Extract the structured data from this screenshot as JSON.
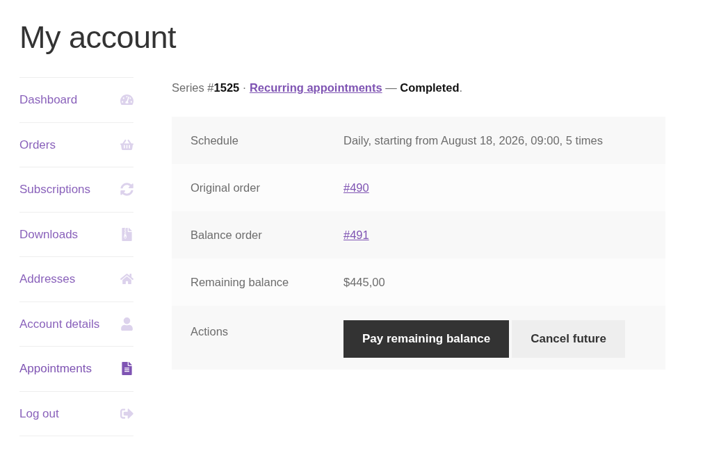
{
  "page": {
    "title": "My account"
  },
  "sidebar": {
    "items": [
      {
        "label": "Dashboard",
        "selected": false
      },
      {
        "label": "Orders",
        "selected": false
      },
      {
        "label": "Subscriptions",
        "selected": false
      },
      {
        "label": "Downloads",
        "selected": false
      },
      {
        "label": "Addresses",
        "selected": false
      },
      {
        "label": "Account details",
        "selected": false
      },
      {
        "label": "Appointments",
        "selected": true
      },
      {
        "label": "Log out",
        "selected": false
      }
    ]
  },
  "series": {
    "text_before": "Series #**1525** · ",
    "link": "Recurring appointments",
    "text_after": " — **Completed**."
  },
  "details": {
    "rows": [
      {
        "kind": "text",
        "label": "Schedule",
        "value": "Daily, starting from August 18, 2026, 09:00, 5 times"
      },
      {
        "kind": "link",
        "label": "Original order",
        "value": "#490"
      },
      {
        "kind": "link",
        "label": "Balance order",
        "value": "#491"
      },
      {
        "kind": "text",
        "label": "Remaining balance",
        "value": "$445,00"
      },
      {
        "kind": "actions",
        "label": "Actions",
        "buttons": [
          {
            "label": "Pay remaining balance",
            "kind": "primary"
          },
          {
            "label": "Cancel future",
            "kind": "secondary"
          }
        ]
      }
    ]
  }
}
